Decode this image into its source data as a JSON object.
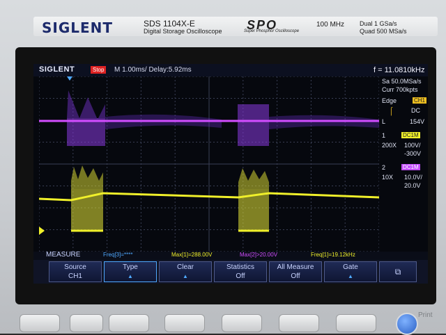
{
  "header": {
    "brand": "SIGLENT",
    "model": "SDS 1104X-E",
    "model_sub": "Digital Storage Oscilloscope",
    "spo": "SPO",
    "spo_sub": "Super Phosphor Oscilloscope",
    "bandwidth": "100 MHz",
    "rate_dual": "Dual  1 GSa/s",
    "rate_quad": "Quad  500 MSa/s"
  },
  "status": {
    "logo": "SIGLENT",
    "state": "Stop",
    "timebase": "M 1.00ms/ Delay:5.92ms",
    "frequency": "f = 11.0810kHz"
  },
  "right_panel": {
    "sample": "Sa 50.0MSa/s",
    "curr": "Curr 700kpts",
    "edge_label": "Edge",
    "edge_ch": "CH1",
    "coupling": "DC",
    "level_label": "L",
    "level_value": "154V",
    "ch1_num": "1",
    "ch1_coupling": "DC1M",
    "ch1_probe": "200X",
    "ch1_scale": "100V/",
    "ch1_offset": "-300V",
    "ch2_num": "2",
    "ch2_coupling": "DC1M",
    "ch2_probe": "10X",
    "ch2_scale": "10.0V/",
    "ch2_offset": "20.0V"
  },
  "measure": {
    "title": "MEASURE",
    "freq3": "Freq[3]=****",
    "max1": "Max[1]=288.00V",
    "max2": "Max[2]>20.00V",
    "freq1": "Freq[1]=19.12kHz"
  },
  "softkeys": [
    {
      "line1": "Source",
      "line2": "CH1"
    },
    {
      "line1": "Type",
      "line2": ""
    },
    {
      "line1": "Clear",
      "line2": ""
    },
    {
      "line1": "Statistics",
      "line2": "Off"
    },
    {
      "line1": "All Measure",
      "line2": "Off"
    },
    {
      "line1": "Gate",
      "line2": ""
    }
  ],
  "colors": {
    "ch1": "#f0f02a",
    "ch2": "#c44dff",
    "grid": "#3a3f55",
    "accent": "#f7c400"
  },
  "print_label": "Print"
}
